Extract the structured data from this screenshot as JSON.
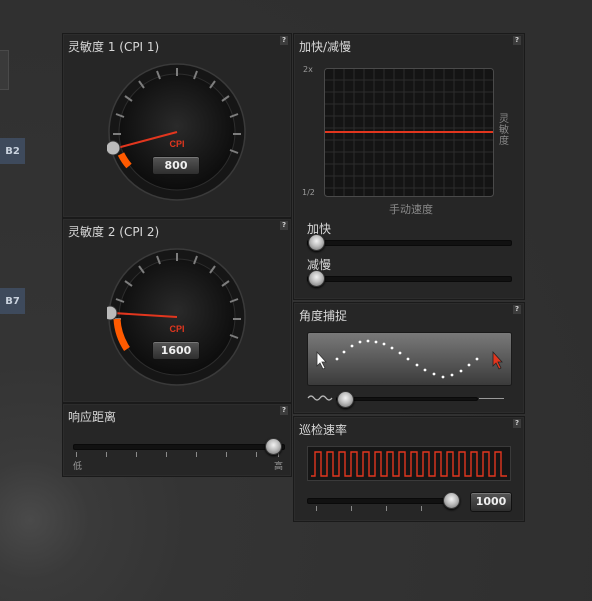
{
  "side_tabs": [
    "B2",
    "B7"
  ],
  "sensitivity1": {
    "title": "灵敏度 1 (CPI 1)",
    "unit": "CPI",
    "value": "800"
  },
  "sensitivity2": {
    "title": "灵敏度 2 (CPI 2)",
    "unit": "CPI",
    "value": "1600"
  },
  "response": {
    "title": "响应距离",
    "low": "低",
    "high": "高"
  },
  "accel": {
    "title": "加快/减慢",
    "y_top": "2x",
    "y_bottom": "1/2",
    "y_label": "灵敏度",
    "x_label": "手动速度",
    "accel_label": "加快",
    "decel_label": "减慢"
  },
  "angle": {
    "title": "角度捕捉"
  },
  "polling": {
    "title": "巡检速率",
    "value": "1000"
  },
  "help_symbol": "?",
  "colors": {
    "accent": "#e2361e",
    "gauge_orange": "#ff5a00",
    "panel_bg": "#262626"
  }
}
